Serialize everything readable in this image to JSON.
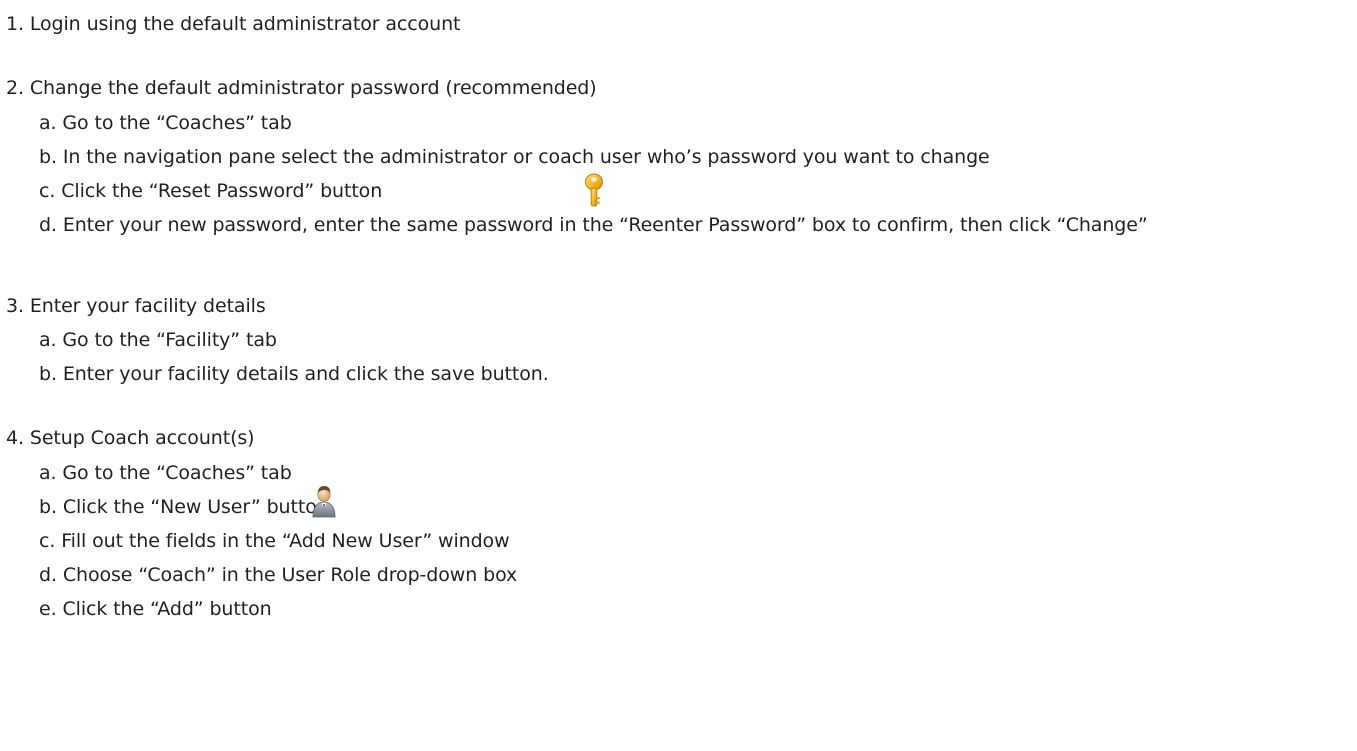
{
  "steps": [
    {
      "title": "1. Login using the default administrator account",
      "substeps": []
    },
    {
      "title": "2. Change the default administrator password (recommended)",
      "substeps": [
        "a. Go to the “Coaches” tab",
        "b. In the navigation pane select the administrator or coach user who’s password you want to change",
        "c. Click the “Reset Password” button",
        "d. Enter your new password, enter the same password in the “Reenter Password” box to confirm, then click “Change”"
      ]
    },
    {
      "title": "3. Enter your facility details",
      "substeps": [
        "a. Go to the “Facility” tab",
        "b. Enter your facility details and click the save button."
      ]
    },
    {
      "title": "4. Setup Coach account(s)",
      "substeps": [
        "a. Go to the “Coaches” tab",
        "b. Click the “New User” button",
        "c. Fill out the fields in the “Add New User” window",
        "d. Choose “Coach” in the User Role drop-down box",
        "e. Click the “Add” button"
      ]
    }
  ],
  "icons": {
    "reset_password": "key-icon",
    "new_user": "user-icon"
  }
}
